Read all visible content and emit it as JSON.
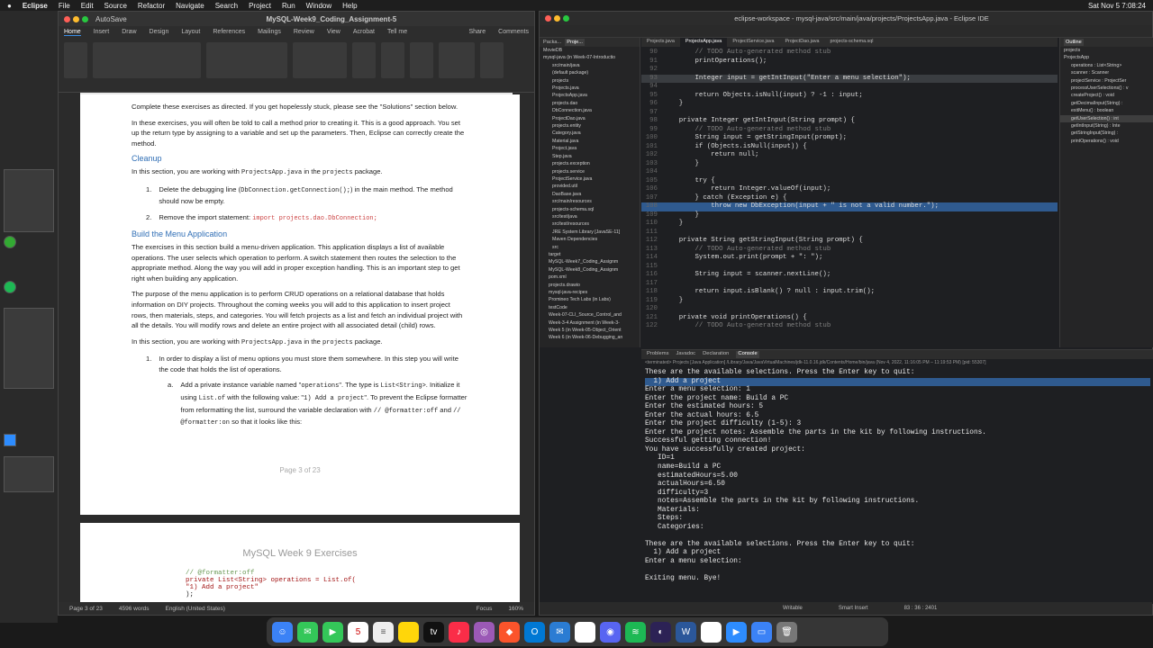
{
  "menubar": {
    "app": "Eclipse",
    "items": [
      "File",
      "Edit",
      "Source",
      "Refactor",
      "Navigate",
      "Search",
      "Project",
      "Run",
      "Window",
      "Help"
    ],
    "clock": "Sat Nov 5  7:08:24"
  },
  "word": {
    "title": "MySQL-Week9_Coding_Assignment-5",
    "autosave": "AutoSave",
    "tabs": [
      "Home",
      "Insert",
      "Draw",
      "Design",
      "Layout",
      "References",
      "Mailings",
      "Review",
      "View",
      "Acrobat",
      "Tell me"
    ],
    "share": "Share",
    "comments": "Comments",
    "p1": {
      "intro": "Complete these exercises as directed. If you get hopelessly stuck, please see the \"Solutions\" section below.",
      "intro2": "In these exercises, you will often be told to call a method prior to creating it. This is a good approach. You set up the return type by assigning to a variable and set up the parameters. Then, Eclipse can correctly create the method.",
      "h_cleanup": "Cleanup",
      "cleanup_intro_a": "In this section, you are working with ",
      "cleanup_file": "ProjectsApp.java",
      "cleanup_intro_b": " in the ",
      "cleanup_pkg": "projects",
      "cleanup_intro_c": " package.",
      "c1_a": "Delete the debugging line (",
      "c1_code": "DbConnection.getConnection();",
      "c1_b": ") in the main method.  The method should now be empty.",
      "c2_a": "Remove the import statement: ",
      "c2_code": "import projects.dao.DbConnection;",
      "h_menu": "Build the Menu Application",
      "menu_p1": "The exercises in this section build a menu-driven application. This application displays a list of available operations. The user selects which operation to perform. A switch statement then routes the selection to the appropriate method. Along the way you will add in proper exception handling. This is an important step to get right when building any application.",
      "menu_p2": "The purpose of the menu application is to perform CRUD operations on a relational database that holds information on DIY projects. Throughout the coming weeks you will add to this application to insert project rows, then materials, steps, and categories. You will fetch projects as a list and fetch an individual project with all the details. You will modify rows and delete an entire project with all associated detail (child) rows.",
      "menu_p3_a": "In this section, you are working with ",
      "menu_p3_file": "ProjectsApp.java",
      "menu_p3_b": " in the ",
      "menu_p3_pkg": "projects",
      "menu_p3_c": " package.",
      "m1": "In order to display a list of menu options you must store them somewhere. In this step you will write the code that holds the list of operations.",
      "ma_1": "Add a private instance variable named \"",
      "ma_2": "operations",
      "ma_3": "\". The type is ",
      "ma_4": "List<String>",
      "ma_5": ". Initialize it using ",
      "ma_6": "List.of",
      "ma_7": " with the following value: \"",
      "ma_8": "1) Add a project",
      "ma_9": "\". To prevent the Eclipse formatter from reformatting the list, surround the variable declaration with ",
      "ma_10": "// @formatter:off",
      "ma_11": " and ",
      "ma_12": "// @formatter:on",
      "ma_13": " so that it looks like this:",
      "page": "Page 3 of 23"
    },
    "p2": {
      "header": "MySQL Week 9 Exercises",
      "code1": "// @formatter:off",
      "code2": "private List<String> operations = List.of(",
      "code3": "    \"1) Add a project\"",
      "code4": ");"
    },
    "status": {
      "page": "Page 3 of 23",
      "words": "4596 words",
      "lang": "English (United States)",
      "focus": "Focus",
      "zoom": "160%"
    }
  },
  "eclipse": {
    "title": "eclipse-workspace - mysql-java/src/main/java/projects/ProjectsApp.java - Eclipse IDE",
    "left_tabs": [
      "Packa...",
      "Proje..."
    ],
    "tree": [
      "MovieDB",
      "mysql-java (in Week-07-Introductio",
      "src/main/java",
      "(default package)",
      "projects",
      "Projects.java",
      "ProjectsApp.java",
      "projects.dao",
      "DbConnection.java",
      "ProjectDao.java",
      "projects.entity",
      "Category.java",
      "Material.java",
      "Project.java",
      "Step.java",
      "projects.exception",
      "projects.service",
      "ProjectService.java",
      "provided.util",
      "DaoBase.java",
      "src/main/resources",
      "projects-schema.sql",
      "src/test/java",
      "src/test/resources",
      "JRE System Library [JavaSE-11]",
      "Maven Dependencies",
      "src",
      "target",
      "MySQL-Week7_Coding_Assignm",
      "MySQL-Week8_Coding_Assignm",
      "pom.xml",
      "projects.drawio",
      "mysql-java-recipes",
      "Promineo Tech Labs (in Labs)",
      "testCode",
      "Week-07-CLI_Source_Control_and",
      "Week-3-4 Assignment (in Week-3-",
      "Week 5 (in Week-05-Object_Orient",
      "Week 6 (in Week-06-Debugging_an"
    ],
    "editor_tabs": [
      "Projects.java",
      "ProjectsApp.java",
      "ProjectService.java",
      "ProjectDao.java",
      "projects-schema.sql"
    ],
    "code": [
      {
        "n": "90",
        "t": "        // TODO Auto-generated method stub",
        "c": "cm"
      },
      {
        "n": "91",
        "t": "        printOperations();",
        "c": ""
      },
      {
        "n": "92",
        "t": "",
        "c": ""
      },
      {
        "n": "93",
        "t": "        Integer input = getIntInput(\"Enter a menu selection\");",
        "c": "hl"
      },
      {
        "n": "94",
        "t": "",
        "c": ""
      },
      {
        "n": "95",
        "t": "        return Objects.isNull(input) ? -1 : input;",
        "c": ""
      },
      {
        "n": "96",
        "t": "    }",
        "c": ""
      },
      {
        "n": "97",
        "t": "",
        "c": ""
      },
      {
        "n": "98",
        "t": "    private Integer getIntInput(String prompt) {",
        "c": ""
      },
      {
        "n": "99",
        "t": "        // TODO Auto-generated method stub",
        "c": "cm"
      },
      {
        "n": "100",
        "t": "        String input = getStringInput(prompt);",
        "c": ""
      },
      {
        "n": "101",
        "t": "        if (Objects.isNull(input)) {",
        "c": ""
      },
      {
        "n": "102",
        "t": "            return null;",
        "c": ""
      },
      {
        "n": "103",
        "t": "        }",
        "c": ""
      },
      {
        "n": "104",
        "t": "",
        "c": ""
      },
      {
        "n": "105",
        "t": "        try {",
        "c": ""
      },
      {
        "n": "106",
        "t": "            return Integer.valueOf(input);",
        "c": ""
      },
      {
        "n": "107",
        "t": "        } catch (Exception e) {",
        "c": ""
      },
      {
        "n": "108",
        "t": "            throw new DbException(input + \" is not a valid number.\");",
        "c": "sel"
      },
      {
        "n": "109",
        "t": "        }",
        "c": ""
      },
      {
        "n": "110",
        "t": "    }",
        "c": ""
      },
      {
        "n": "111",
        "t": "",
        "c": ""
      },
      {
        "n": "112",
        "t": "    private String getStringInput(String prompt) {",
        "c": ""
      },
      {
        "n": "113",
        "t": "        // TODO Auto-generated method stub",
        "c": "cm"
      },
      {
        "n": "114",
        "t": "        System.out.print(prompt + \": \");",
        "c": ""
      },
      {
        "n": "115",
        "t": "",
        "c": ""
      },
      {
        "n": "116",
        "t": "        String input = scanner.nextLine();",
        "c": ""
      },
      {
        "n": "117",
        "t": "",
        "c": ""
      },
      {
        "n": "118",
        "t": "        return input.isBlank() ? null : input.trim();",
        "c": ""
      },
      {
        "n": "119",
        "t": "    }",
        "c": ""
      },
      {
        "n": "120",
        "t": "",
        "c": ""
      },
      {
        "n": "121",
        "t": "    private void printOperations() {",
        "c": ""
      },
      {
        "n": "122",
        "t": "        // TODO Auto-generated method stub",
        "c": "cm"
      }
    ],
    "outline_title": "Outline",
    "outline": [
      "projects",
      "ProjectsApp",
      "operations : List<String>",
      "scanner : Scanner",
      "projectService : ProjectSer",
      "processUserSelections() : v",
      "createProject() : void",
      "getDecimalInput(String) :",
      "exitMenu() : boolean",
      "getUserSelection() : int",
      "getIntInput(String) : Inte",
      "getStringInput(String) :",
      "printOperations() : void"
    ],
    "console_tabs": [
      "Problems",
      "Javadoc",
      "Declaration",
      "Console"
    ],
    "terminated": "<terminated> Projects [Java Application] /Library/Java/JavaVirtualMachines/jdk-11.0.16.jdk/Contents/Home/bin/java  (Nov 4, 2022, 11:16:05 PM – 11:19:53 PM) [pid: 55307]",
    "console": [
      "These are the available selections. Press the Enter key to quit:",
      "  1) Add a project",
      "Enter a menu selection: 1",
      "Enter the project name: Build a PC",
      "Enter the estimated hours: 5",
      "Enter the actual hours: 6.5",
      "Enter the project difficulty (1-5): 3",
      "Enter the project notes: Assemble the parts in the kit by following instructions.",
      "Successful getting connection!",
      "You have successfully created project:",
      "   ID=1",
      "   name=Build a PC",
      "   estimatedHours=5.00",
      "   actualHours=6.50",
      "   difficulty=3",
      "   notes=Assemble the parts in the kit by following instructions.",
      "   Materials:",
      "   Steps:",
      "   Categories:",
      "",
      "These are the available selections. Press the Enter key to quit:",
      "  1) Add a project",
      "Enter a menu selection:",
      "",
      "Exiting menu. Bye!"
    ],
    "status": {
      "mode": "Writable",
      "insert": "Smart Insert",
      "pos": "83 : 36 : 2401"
    }
  },
  "dock": {
    "calendar_day": "5",
    "tv": "tv"
  }
}
